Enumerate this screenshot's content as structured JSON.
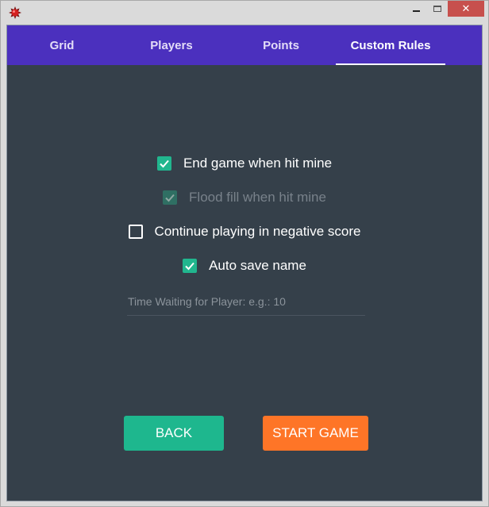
{
  "window": {
    "app_icon": "mine-icon",
    "controls": {
      "minimize": "minimize-icon",
      "maximize": "maximize-icon",
      "close": "close-icon",
      "close_glyph": "✕"
    }
  },
  "tabs": [
    {
      "label": "Grid",
      "active": false
    },
    {
      "label": "Players",
      "active": false
    },
    {
      "label": "Points",
      "active": false
    },
    {
      "label": "Custom Rules",
      "active": true
    }
  ],
  "rules": [
    {
      "label": "End game when hit mine",
      "checked": true,
      "enabled": true
    },
    {
      "label": "Flood fill when hit mine",
      "checked": true,
      "enabled": false
    },
    {
      "label": "Continue playing in negative score",
      "checked": false,
      "enabled": true
    },
    {
      "label": "Auto save name",
      "checked": true,
      "enabled": true
    }
  ],
  "time_field": {
    "value": "",
    "placeholder": "Time Waiting for Player: e.g.: 10"
  },
  "buttons": {
    "back": "BACK",
    "start": "START GAME"
  },
  "colors": {
    "tab_bar": "#4b30be",
    "background": "#35404a",
    "checkbox": "#21b68e",
    "back_button": "#1eb78e",
    "start_button": "#fe7527",
    "close_button": "#c7504d"
  }
}
